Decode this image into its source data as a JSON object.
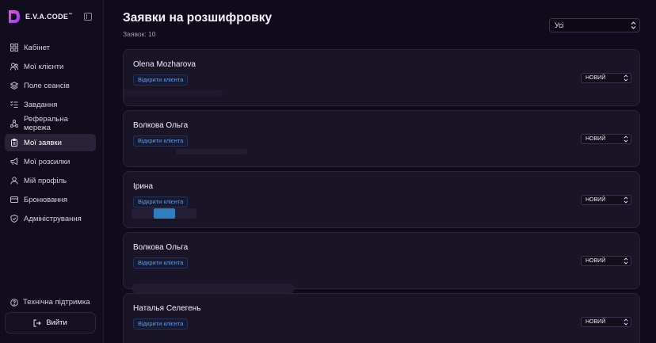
{
  "app": {
    "name": "E.V.A.CODE",
    "trademark": "™"
  },
  "sidebar": {
    "items": [
      {
        "label": "Кабінет",
        "icon": "dashboard-icon",
        "active": false
      },
      {
        "label": "Мої клієнти",
        "icon": "users-icon",
        "active": false
      },
      {
        "label": "Поле сеансів",
        "icon": "stack-icon",
        "active": false
      },
      {
        "label": "Завдання",
        "icon": "tasks-icon",
        "active": false
      },
      {
        "label": "Реферальна мережа",
        "icon": "network-icon",
        "active": false
      },
      {
        "label": "Мої заявки",
        "icon": "clipboard-icon",
        "active": true
      },
      {
        "label": "Мої розсилки",
        "icon": "megaphone-icon",
        "active": false
      },
      {
        "label": "Мій профіль",
        "icon": "user-icon",
        "active": false
      },
      {
        "label": "Бронювання",
        "icon": "card-icon",
        "active": false
      },
      {
        "label": "Адміністрування",
        "icon": "shield-icon",
        "active": false
      }
    ],
    "support_label": "Технічна підтримка",
    "logout_label": "Вийти"
  },
  "main": {
    "title": "Заявки на розшифровку",
    "count_text": "Заявок: 10",
    "filter": {
      "selected": "Усі"
    },
    "open_client_label": "Відкрити клієнта",
    "requests": [
      {
        "name": "Olena Mozharova",
        "status": "НОВИЙ"
      },
      {
        "name": "Волкова Ольга",
        "status": "НОВИЙ"
      },
      {
        "name": "Ірина",
        "status": "НОВИЙ"
      },
      {
        "name": "Волкова Ольга",
        "status": "НОВИЙ"
      },
      {
        "name": "Наталья Селегень",
        "status": "НОВИЙ"
      }
    ]
  },
  "colors": {
    "background": "#100b1a",
    "card": "#1a1427",
    "accent_link": "#5f9cf3",
    "active_nav": "#2a2238"
  }
}
